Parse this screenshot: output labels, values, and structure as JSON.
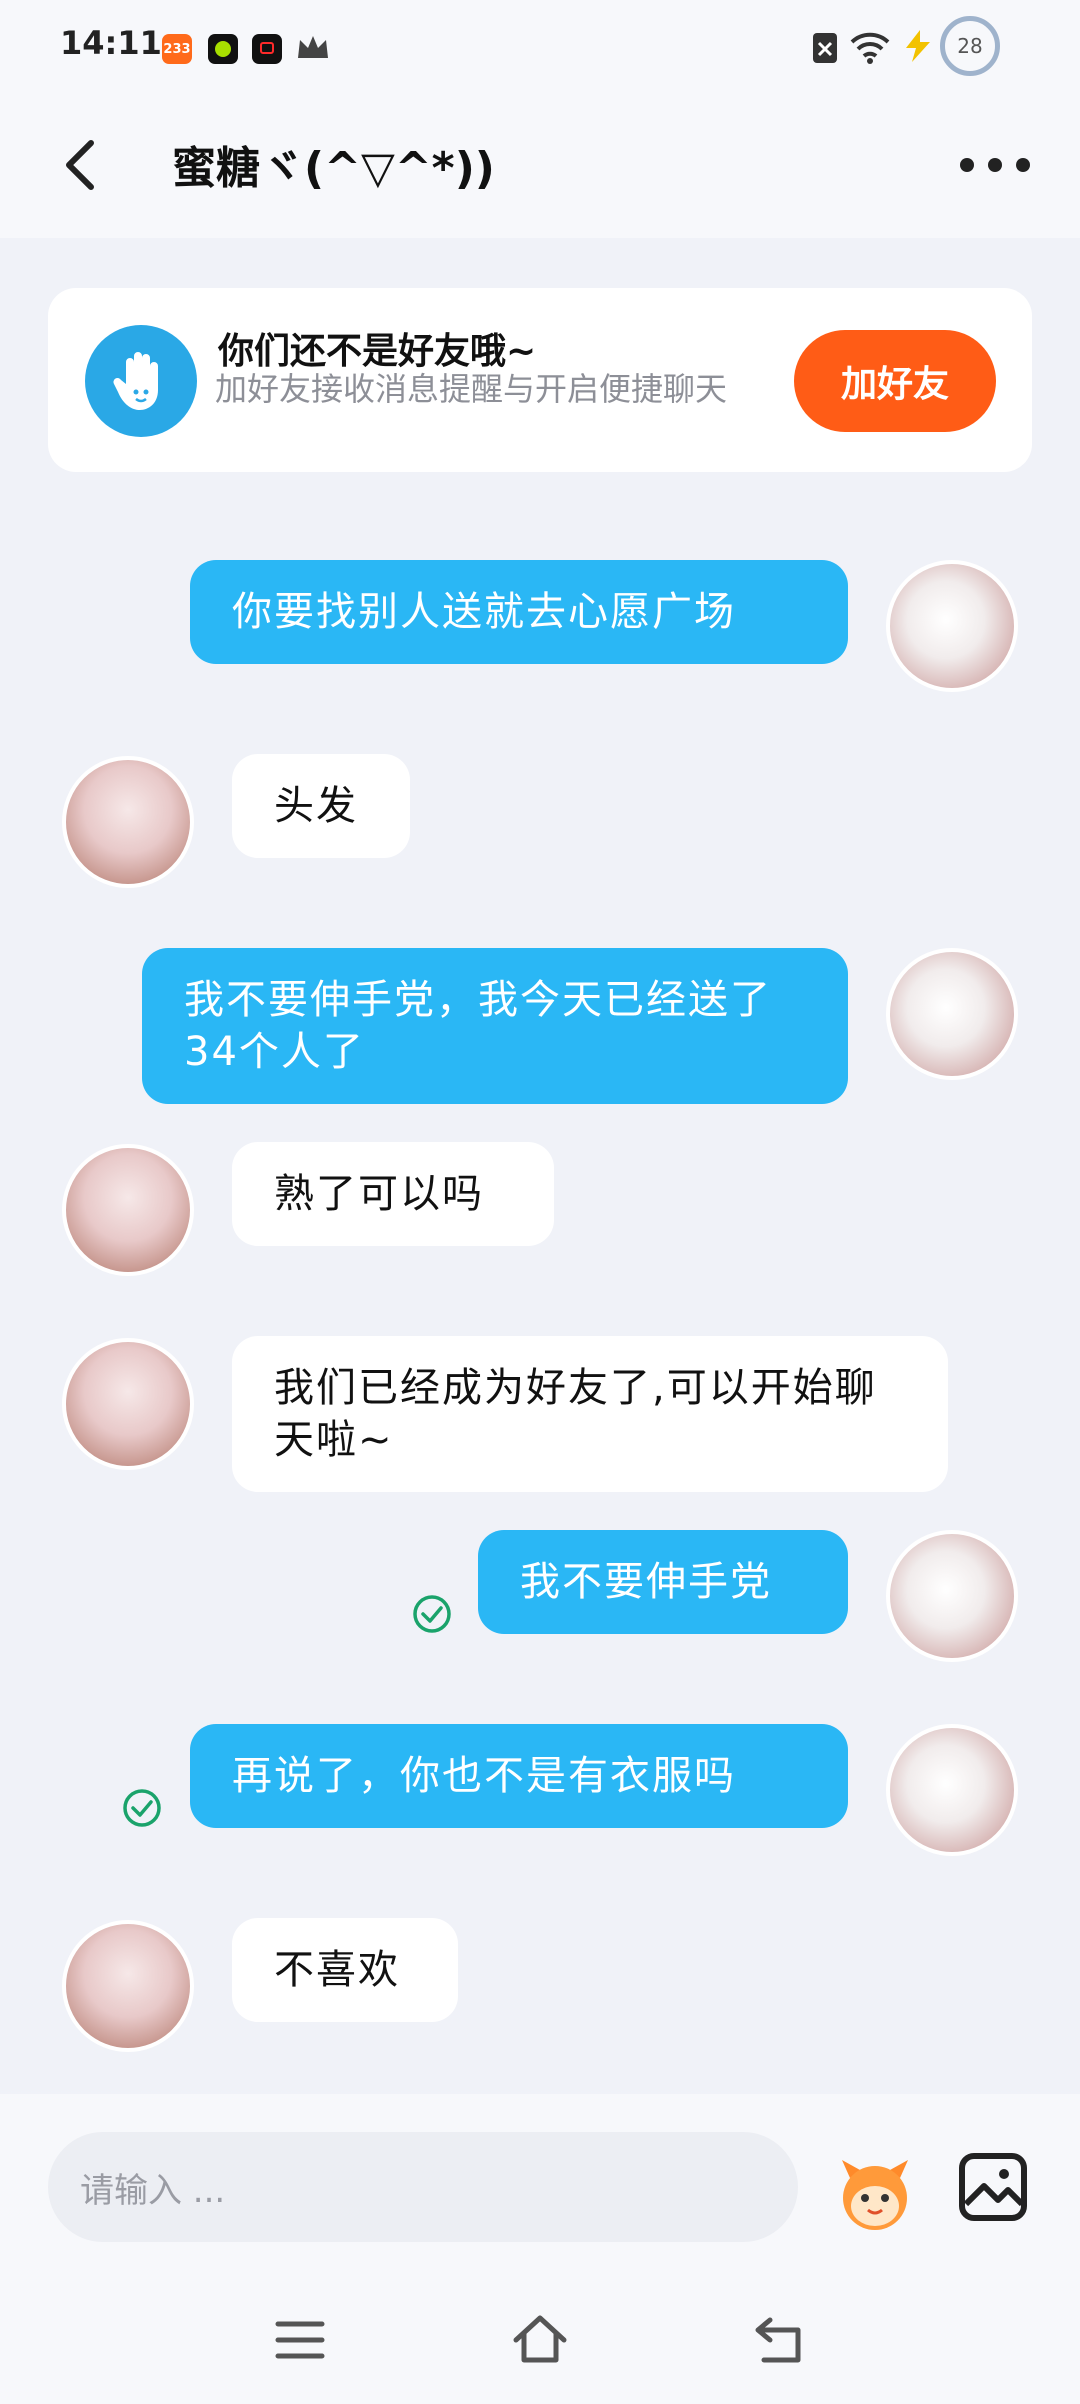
{
  "status_bar": {
    "time": "14:11",
    "notif_badge": "233",
    "battery": "28",
    "icons": [
      "app-233-icon",
      "app-green-icon",
      "app-red-icon",
      "crown-icon",
      "sim-x-icon",
      "wifi-icon",
      "charging-icon"
    ]
  },
  "header": {
    "title": "蜜糖ヾ(^▽^*))"
  },
  "friend_notice": {
    "title": "你们还不是好友哦~",
    "subtitle": "加好友接收消息提醒与开启便捷聊天",
    "button": "加好友"
  },
  "messages": [
    {
      "from": "me",
      "text": "你要找别人送就去心愿广场"
    },
    {
      "from": "them",
      "text": "头发"
    },
    {
      "from": "me",
      "text": "我不要伸手党，我今天已经送了34个人了"
    },
    {
      "from": "them",
      "text": "熟了可以吗"
    },
    {
      "from": "them",
      "text": "我们已经成为好友了,可以开始聊天啦~"
    },
    {
      "from": "me",
      "text": "我不要伸手党",
      "read": true
    },
    {
      "from": "me",
      "text": "再说了，你也不是有衣服吗",
      "read": true
    },
    {
      "from": "them",
      "text": "不喜欢"
    }
  ],
  "input": {
    "placeholder": "请输入 ..."
  },
  "colors": {
    "me_bubble": "#2ab7f5",
    "them_bubble": "#ffffff",
    "add_button": "#ff5c16",
    "background": "#f0f2f8",
    "read_check": "#1aa36b"
  }
}
